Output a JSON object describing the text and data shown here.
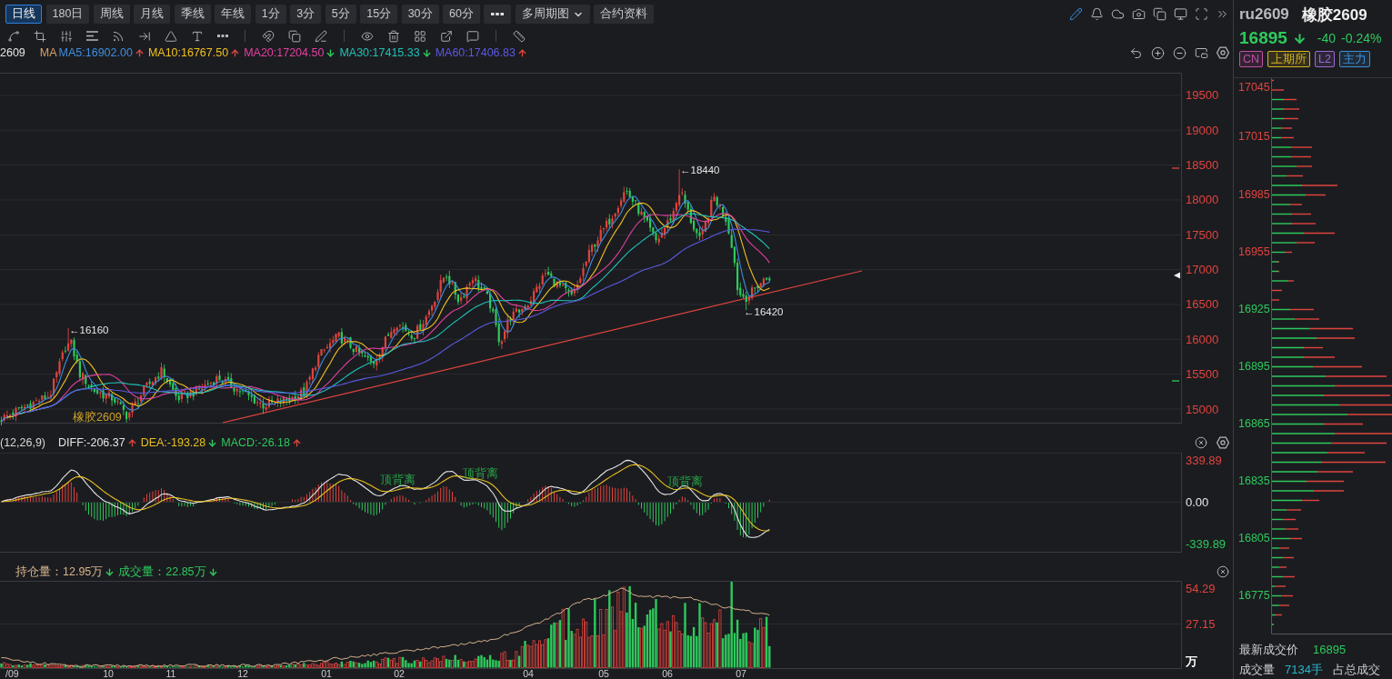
{
  "toolbar": {
    "periods": [
      {
        "label": "日线",
        "selected": true
      },
      {
        "label": "180日",
        "selected": false
      },
      {
        "label": "周线",
        "selected": false
      },
      {
        "label": "月线",
        "selected": false
      },
      {
        "label": "季线",
        "selected": false
      },
      {
        "label": "年线",
        "selected": false
      },
      {
        "label": "1分",
        "selected": false
      },
      {
        "label": "3分",
        "selected": false
      },
      {
        "label": "5分",
        "selected": false
      },
      {
        "label": "15分",
        "selected": false
      },
      {
        "label": "30分",
        "selected": false
      },
      {
        "label": "60分",
        "selected": false
      }
    ],
    "multi_period": "多周期图",
    "contract_info": "合约资料"
  },
  "price_chart": {
    "symbol": "2609",
    "ma_title": "MA",
    "ma_lines": [
      {
        "label": "MA5:16902.00",
        "color": "#3e8ede",
        "rising": true
      },
      {
        "label": "MA10:16767.50",
        "color": "#f0c020",
        "rising": true
      },
      {
        "label": "MA20:17204.50",
        "color": "#e040a0",
        "rising": false
      },
      {
        "label": "MA30:17415.33",
        "color": "#20c0b8",
        "rising": false
      },
      {
        "label": "MA60:17406.83",
        "color": "#5a5ae0",
        "rising": true
      }
    ],
    "axis": [
      "19500",
      "19000",
      "18500",
      "18000",
      "17500",
      "17000",
      "16500",
      "16000",
      "15500",
      "15000"
    ],
    "annotations": [
      "←18440",
      "←16160",
      "←16420"
    ],
    "contract_label": "橡胶2609"
  },
  "macd": {
    "title": "(12,26,9)",
    "values": [
      {
        "label": "DIFF:-206.37",
        "color": "#e6e6e6",
        "rising": true
      },
      {
        "label": "DEA:-193.28",
        "color": "#e8c020",
        "rising": false
      },
      {
        "label": "MACD:-26.18",
        "color": "#2ec95c",
        "rising": true
      }
    ],
    "axis": [
      {
        "text": "339.89",
        "color": "#e0443e"
      },
      {
        "text": "0.00",
        "color": "#e6e6e6"
      },
      {
        "text": "-339.89",
        "color": "#2ec95c"
      }
    ],
    "divergence_labels": [
      "顶背离",
      "顶背离",
      "顶背离"
    ]
  },
  "volume": {
    "values": [
      {
        "label": "持仓量：12.95万",
        "color": "#d8b48c",
        "rising": false
      },
      {
        "label": "成交量：22.85万",
        "color": "#2ec95c",
        "rising": false
      }
    ],
    "axis": [
      {
        "text": "54.29",
        "color": "#e0443e"
      },
      {
        "text": "27.15",
        "color": "#e0443e"
      },
      {
        "text": "万",
        "color": "#ffffff"
      }
    ]
  },
  "date_axis": [
    "/09",
    "10",
    "11",
    "12",
    "01",
    "02",
    "04",
    "05",
    "06",
    "07"
  ],
  "quote": {
    "code": "ru2609",
    "name": "橡胶2609",
    "price": "16895",
    "falling": true,
    "change": "-40",
    "change_pct": "-0.24%",
    "tags": [
      {
        "label": "CN",
        "color": "#c24fa6"
      },
      {
        "label": "上期所",
        "color": "#d6b21c"
      },
      {
        "label": "L2",
        "color": "#9a6ad0"
      },
      {
        "label": "主力",
        "color": "#3a92dc"
      }
    ]
  },
  "profile": {
    "prices": [
      {
        "text": "17045",
        "color": "#e0443e"
      },
      {
        "text": "17015",
        "color": "#e0443e"
      },
      {
        "text": "16985",
        "color": "#e0443e"
      },
      {
        "text": "16955",
        "color": "#e0443e"
      },
      {
        "text": "16925",
        "color": "#2ec95c"
      },
      {
        "text": "16895",
        "color": "#2ec95c"
      },
      {
        "text": "16865",
        "color": "#2ec95c"
      },
      {
        "text": "16835",
        "color": "#2ec95c"
      },
      {
        "text": "16805",
        "color": "#2ec95c"
      },
      {
        "text": "16775",
        "color": "#2ec95c"
      }
    ]
  },
  "footer": {
    "last_price_label": "最新成交价",
    "last_price": "16895",
    "volume_label": "成交量",
    "volume": "7134手",
    "share_label": "占总成交"
  }
}
